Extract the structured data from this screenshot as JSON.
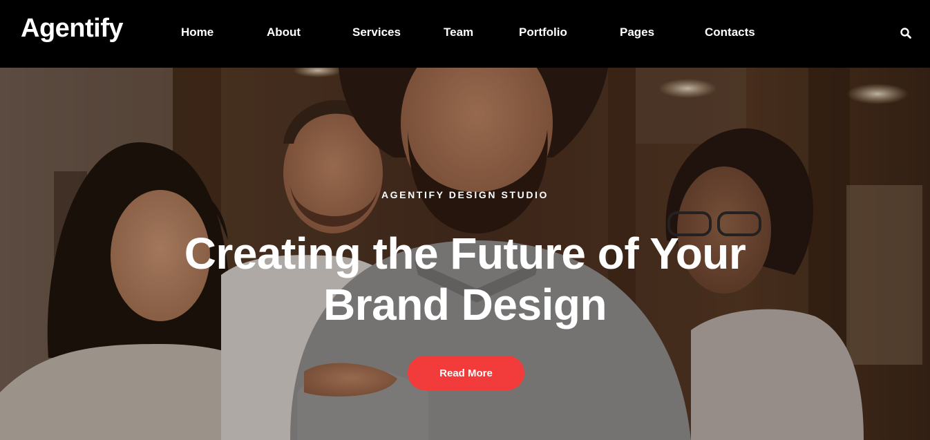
{
  "brand": {
    "name": "Agentify"
  },
  "nav": {
    "items": [
      {
        "label": "Home"
      },
      {
        "label": "About"
      },
      {
        "label": "Services"
      },
      {
        "label": "Team"
      },
      {
        "label": "Portfolio"
      },
      {
        "label": "Pages"
      },
      {
        "label": "Contacts"
      }
    ],
    "search_icon": "search-icon"
  },
  "hero": {
    "eyebrow": "AGENTIFY DESIGN STUDIO",
    "headline_line1": "Creating the Future of Your",
    "headline_line2": "Brand Design",
    "cta_label": "Read More",
    "accent_color": "#f23c3c",
    "image_description": "team-photo"
  }
}
